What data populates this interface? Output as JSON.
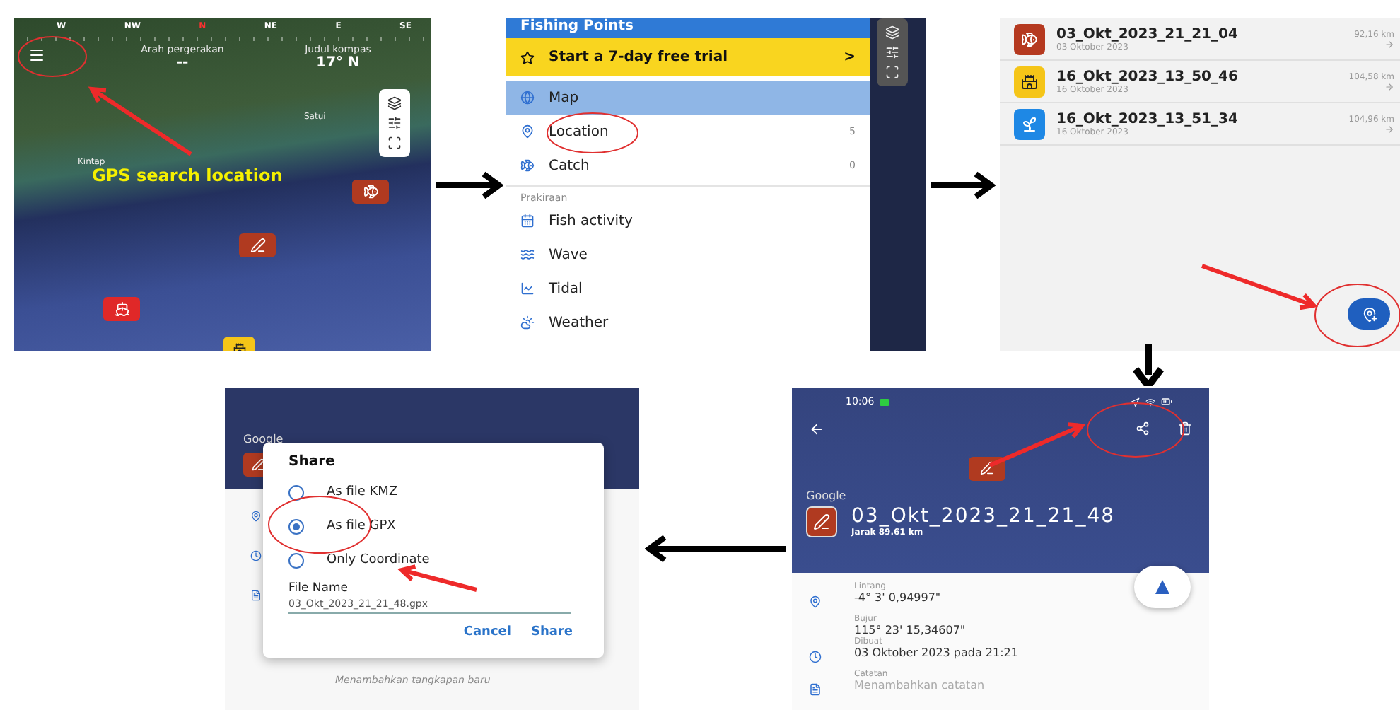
{
  "map_screen": {
    "compass": [
      {
        "label": "W",
        "highlighted": false
      },
      {
        "label": "NW",
        "highlighted": false
      },
      {
        "label": "N",
        "highlighted": true
      },
      {
        "label": "NE",
        "highlighted": false
      },
      {
        "label": "E",
        "highlighted": false
      },
      {
        "label": "SE",
        "highlighted": false
      }
    ],
    "heading_label": "Arah pergerakan",
    "heading_value": "--",
    "compass_label": "Judul kompas",
    "compass_value": "17° N",
    "places": [
      "Satui",
      "Kintap"
    ],
    "annotation": "GPS search location"
  },
  "menu_screen": {
    "title": "Fishing Points",
    "trial": {
      "label": "Start a 7-day free trial",
      "chevron": ">"
    },
    "items": [
      {
        "label": "Map",
        "selected": true
      },
      {
        "label": "Location",
        "count": "5",
        "selected": false
      },
      {
        "label": "Catch",
        "count": "0",
        "selected": false
      }
    ],
    "section": "Prakiraan",
    "forecast": [
      "Fish activity",
      "Wave",
      "Tidal",
      "Weather"
    ]
  },
  "list_screen": {
    "items": [
      {
        "kind": "catch",
        "color": "#b5391f",
        "name": "03_Okt_2023_21_21_04",
        "date": "03 Oktober 2023",
        "distance": "92,16 km"
      },
      {
        "kind": "lighthouse",
        "color": "#f5c518",
        "name": "16_Okt_2023_13_50_46",
        "date": "16 Oktober 2023",
        "distance": "104,58 km"
      },
      {
        "kind": "weed",
        "color": "#1e88e5",
        "name": "16_Okt_2023_13_51_34",
        "date": "16 Oktober 2023",
        "distance": "104,96 km"
      }
    ]
  },
  "share_screen": {
    "map_label": "Google",
    "footer": "Menambahkan tangkapan baru",
    "dialog": {
      "title": "Share",
      "options": [
        {
          "label": "As file KMZ",
          "selected": false
        },
        {
          "label": "As file GPX",
          "selected": true
        },
        {
          "label": "Only Coordinate",
          "selected": false
        }
      ],
      "file_label": "File Name",
      "file_name": "03_Okt_2023_21_21_48.gpx",
      "buttons": [
        "Cancel",
        "Share"
      ]
    }
  },
  "detail_screen": {
    "time": "10:06",
    "map_label": "Google",
    "title": "03_Okt_2023_21_21_48",
    "distance": "Jarak 89.61 km",
    "fields": [
      {
        "kind": "location",
        "label": "Lintang",
        "value": "-4° 3' 0,94997\""
      },
      {
        "kind": "none",
        "label": "Bujur",
        "value": "115° 23' 15,34607\""
      },
      {
        "kind": "time",
        "label": "Dibuat",
        "value": "03 Oktober 2023 pada 21:21"
      },
      {
        "kind": "note",
        "label": "Catatan",
        "placeholder": "Menambahkan catatan"
      }
    ]
  }
}
